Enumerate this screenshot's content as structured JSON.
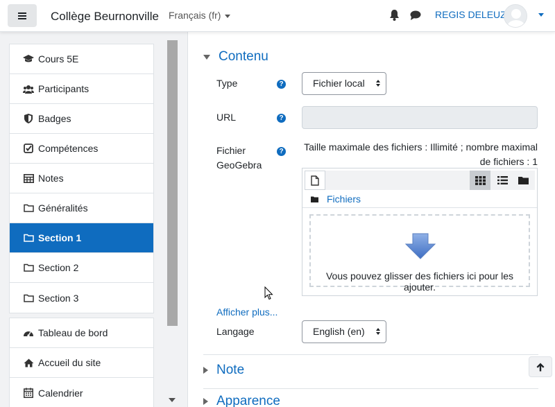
{
  "navbar": {
    "site_name": "Collège Beurnonville",
    "language": "Français (fr)",
    "user_name": "REGIS DELEUZE"
  },
  "sidebar": {
    "course_items": [
      {
        "label": "Cours 5E",
        "icon": "graduation-cap-icon"
      },
      {
        "label": "Participants",
        "icon": "users-icon"
      },
      {
        "label": "Badges",
        "icon": "shield-icon"
      },
      {
        "label": "Compétences",
        "icon": "checkbox-icon"
      },
      {
        "label": "Notes",
        "icon": "table-icon"
      },
      {
        "label": "Généralités",
        "icon": "folder-icon"
      },
      {
        "label": "Section 1",
        "icon": "folder-icon",
        "active": true
      },
      {
        "label": "Section 2",
        "icon": "folder-icon"
      },
      {
        "label": "Section 3",
        "icon": "folder-icon"
      }
    ],
    "site_items": [
      {
        "label": "Tableau de bord",
        "icon": "dashboard-icon"
      },
      {
        "label": "Accueil du site",
        "icon": "home-icon"
      },
      {
        "label": "Calendrier",
        "icon": "calendar-icon"
      }
    ]
  },
  "form": {
    "section_contenu": "Contenu",
    "type_label": "Type",
    "type_value": "Fichier local",
    "url_label": "URL",
    "url_value": "",
    "file_label_line1": "Fichier",
    "file_label_line2": "GeoGebra",
    "max_info_line1": "Taille maximale des fichiers : Illimité ; nombre maximal",
    "max_info_line2": "de fichiers : 1",
    "files_path": "Fichiers",
    "drop_text": "Vous pouvez glisser des fichiers ici pour les ajouter.",
    "show_more": "Afficher plus...",
    "language_label": "Langage",
    "language_value": "English (en)",
    "section_note": "Note",
    "section_appearance": "Apparence"
  },
  "colors": {
    "accent": "#0f6cbf",
    "active_bg": "#0f6cbf"
  }
}
